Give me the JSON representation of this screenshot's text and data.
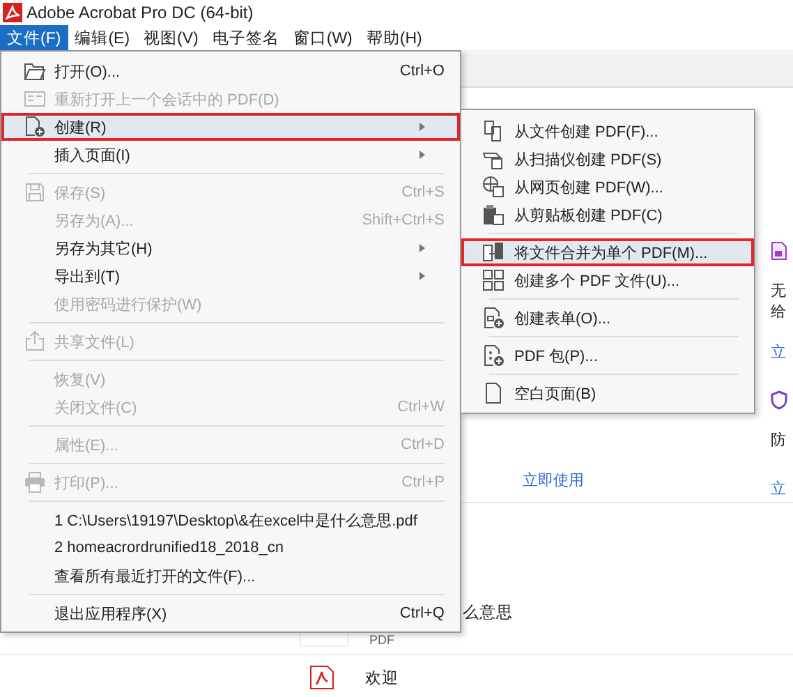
{
  "window": {
    "title": "Adobe Acrobat Pro DC (64-bit)"
  },
  "menubar": [
    {
      "label": "文件(F)",
      "selected": true
    },
    {
      "label": "编辑(E)",
      "selected": false
    },
    {
      "label": "视图(V)",
      "selected": false
    },
    {
      "label": "电子签名",
      "selected": false
    },
    {
      "label": "窗口(W)",
      "selected": false
    },
    {
      "label": "帮助(H)",
      "selected": false
    }
  ],
  "file_menu": [
    {
      "kind": "item",
      "label": "打开(O)...",
      "shortcut": "Ctrl+O",
      "disabled": false,
      "selected": false,
      "submenu": false,
      "outlined": false
    },
    {
      "kind": "item",
      "label": "重新打开上一个会话中的 PDF(D)",
      "disabled": true,
      "selected": false,
      "submenu": false,
      "outlined": false
    },
    {
      "kind": "item",
      "label": "创建(R)",
      "disabled": false,
      "selected": true,
      "submenu": true,
      "outlined": true
    },
    {
      "kind": "item",
      "label": "插入页面(I)",
      "disabled": false,
      "selected": false,
      "submenu": true,
      "outlined": false
    },
    {
      "kind": "separator"
    },
    {
      "kind": "item",
      "label": "保存(S)",
      "shortcut": "Ctrl+S",
      "disabled": true,
      "selected": false,
      "submenu": false,
      "outlined": false
    },
    {
      "kind": "item",
      "label": "另存为(A)...",
      "shortcut": "Shift+Ctrl+S",
      "disabled": true,
      "selected": false,
      "submenu": false,
      "outlined": false
    },
    {
      "kind": "item",
      "label": "另存为其它(H)",
      "disabled": false,
      "selected": false,
      "submenu": true,
      "outlined": false
    },
    {
      "kind": "item",
      "label": "导出到(T)",
      "disabled": false,
      "selected": false,
      "submenu": true,
      "outlined": false
    },
    {
      "kind": "item",
      "label": "使用密码进行保护(W)",
      "disabled": true,
      "selected": false,
      "submenu": false,
      "outlined": false
    },
    {
      "kind": "separator"
    },
    {
      "kind": "item",
      "label": "共享文件(L)",
      "disabled": true,
      "selected": false,
      "submenu": false,
      "outlined": false
    },
    {
      "kind": "separator"
    },
    {
      "kind": "item",
      "label": "恢复(V)",
      "disabled": true,
      "selected": false,
      "submenu": false,
      "outlined": false
    },
    {
      "kind": "item",
      "label": "关闭文件(C)",
      "shortcut": "Ctrl+W",
      "disabled": true,
      "selected": false,
      "submenu": false,
      "outlined": false
    },
    {
      "kind": "separator"
    },
    {
      "kind": "item",
      "label": "属性(E)...",
      "shortcut": "Ctrl+D",
      "disabled": true,
      "selected": false,
      "submenu": false,
      "outlined": false
    },
    {
      "kind": "separator"
    },
    {
      "kind": "item",
      "label": "打印(P)...",
      "shortcut": "Ctrl+P",
      "disabled": true,
      "selected": false,
      "submenu": false,
      "outlined": false
    },
    {
      "kind": "separator"
    },
    {
      "kind": "item",
      "label": "1 C:\\Users\\19197\\Desktop\\&在excel中是什么意思.pdf",
      "disabled": false,
      "selected": false,
      "submenu": false,
      "outlined": false
    },
    {
      "kind": "item",
      "label": "2 homeacrordrunified18_2018_cn",
      "disabled": false,
      "selected": false,
      "submenu": false,
      "outlined": false
    },
    {
      "kind": "item",
      "label": "查看所有最近打开的文件(F)...",
      "disabled": false,
      "selected": false,
      "submenu": false,
      "outlined": false
    },
    {
      "kind": "separator"
    },
    {
      "kind": "item",
      "label": "退出应用程序(X)",
      "shortcut": "Ctrl+Q",
      "disabled": false,
      "selected": false,
      "submenu": false,
      "outlined": false
    }
  ],
  "create_submenu": [
    {
      "kind": "item",
      "label": "从文件创建 PDF(F)...",
      "selected": false,
      "outlined": false
    },
    {
      "kind": "item",
      "label": "从扫描仪创建 PDF(S)",
      "selected": false,
      "outlined": false
    },
    {
      "kind": "item",
      "label": "从网页创建 PDF(W)...",
      "selected": false,
      "outlined": false
    },
    {
      "kind": "item",
      "label": "从剪贴板创建 PDF(C)",
      "selected": false,
      "outlined": false
    },
    {
      "kind": "separator"
    },
    {
      "kind": "item",
      "label": "将文件合并为单个 PDF(M)...",
      "selected": true,
      "outlined": true
    },
    {
      "kind": "item",
      "label": "创建多个 PDF 文件(U)...",
      "selected": false,
      "outlined": false
    },
    {
      "kind": "separator"
    },
    {
      "kind": "item",
      "label": "创建表单(O)...",
      "selected": false,
      "outlined": false
    },
    {
      "kind": "separator"
    },
    {
      "kind": "item",
      "label": "PDF 包(P)...",
      "selected": false,
      "outlined": false
    },
    {
      "kind": "separator"
    },
    {
      "kind": "item",
      "label": "空白页面(B)",
      "selected": false,
      "outlined": false
    }
  ],
  "background": {
    "card_link": "立即使用",
    "side_card_1": {
      "lines": [
        "无",
        "给"
      ],
      "link": "立"
    },
    "side_card_2": {
      "lines": [
        "防"
      ],
      "link": "立"
    },
    "recent_file": {
      "title": "么意思",
      "type": "PDF"
    },
    "welcome": "欢迎"
  }
}
